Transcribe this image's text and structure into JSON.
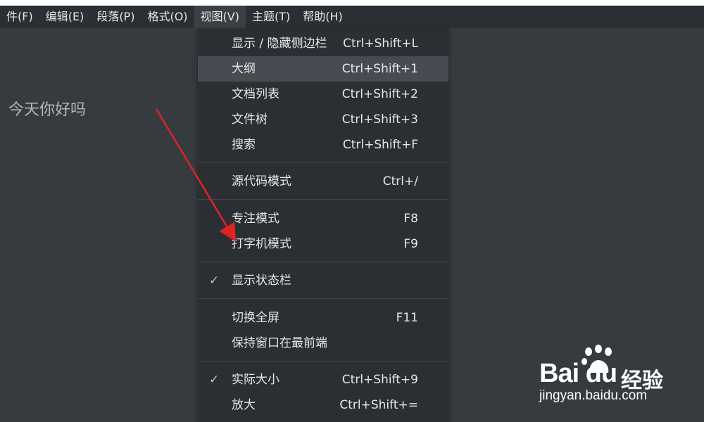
{
  "menubar": {
    "items": [
      {
        "label": "件(F)"
      },
      {
        "label": "编辑(E)"
      },
      {
        "label": "段落(P)"
      },
      {
        "label": "格式(O)"
      },
      {
        "label": "视图(V)"
      },
      {
        "label": "主题(T)"
      },
      {
        "label": "帮助(H)"
      }
    ],
    "active_index": 4
  },
  "editor": {
    "text": "今天你好吗"
  },
  "view_menu": {
    "items": [
      {
        "label": "显示 / 隐藏侧边栏",
        "shortcut": "Ctrl+Shift+L"
      },
      {
        "label": "大纲",
        "shortcut": "Ctrl+Shift+1",
        "highlighted": true
      },
      {
        "label": "文档列表",
        "shortcut": "Ctrl+Shift+2"
      },
      {
        "label": "文件树",
        "shortcut": "Ctrl+Shift+3"
      },
      {
        "label": "搜索",
        "shortcut": "Ctrl+Shift+F"
      },
      {
        "label": "源代码模式",
        "shortcut": "Ctrl+/"
      },
      {
        "label": "专注模式",
        "shortcut": "F8"
      },
      {
        "label": "打字机模式",
        "shortcut": "F9"
      },
      {
        "label": "显示状态栏",
        "shortcut": "",
        "checked": true
      },
      {
        "label": "切换全屏",
        "shortcut": "F11"
      },
      {
        "label": "保持窗口在最前端",
        "shortcut": ""
      },
      {
        "label": "实际大小",
        "shortcut": "Ctrl+Shift+9",
        "checked": true
      },
      {
        "label": "放大",
        "shortcut": "Ctrl+Shift+="
      }
    ],
    "check_glyph": "✓"
  },
  "annotation": {
    "arrow_color": "#e02424"
  },
  "watermark": {
    "brand": "Bai du",
    "product": "经验",
    "url": "jingyan.baidu.com"
  },
  "colors": {
    "background": "#363b40",
    "menubar": "#2b2f33",
    "menu_hover": "#474c52",
    "text": "#e6e6e6"
  }
}
